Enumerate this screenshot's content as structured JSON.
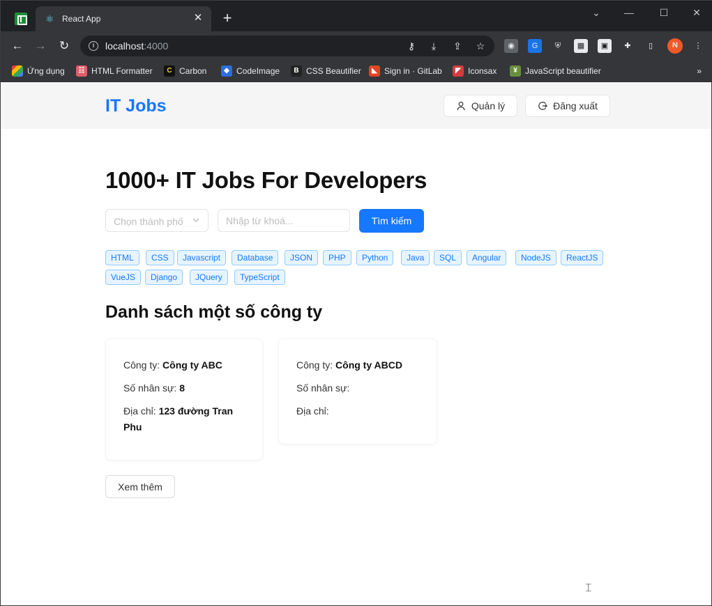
{
  "browser": {
    "tab_title": "React App",
    "url_host": "localhost",
    "url_port": ":4000",
    "bookmarks": [
      {
        "label": "Ứng dụng",
        "icon": "apps-grid-icon",
        "color": "#ea4335"
      },
      {
        "label": "HTML Formatter",
        "icon": "html-formatter-icon",
        "color": "#e25d6b"
      },
      {
        "label": "Carbon",
        "icon": "carbon-icon",
        "color": "#111111"
      },
      {
        "label": "CodeImage",
        "icon": "codeimage-icon",
        "color": "#2d6cdf"
      },
      {
        "label": "CSS Beautifier",
        "icon": "css-beautifier-icon",
        "color": "#222222"
      },
      {
        "label": "Sign in · GitLab",
        "icon": "gitlab-icon",
        "color": "#e24329"
      },
      {
        "label": "Iconsax",
        "icon": "iconsax-icon",
        "color": "#d43c3c"
      },
      {
        "label": "JavaScript beautifier",
        "icon": "js-beautifier-icon",
        "color": "#6a8f3c"
      }
    ],
    "bookmarks_more": "»",
    "profile_initial": "N"
  },
  "header": {
    "logo": "IT Jobs",
    "manage_label": "Quản lý",
    "logout_label": "Đăng xuất"
  },
  "hero": {
    "title": "1000+ IT Jobs For Developers",
    "city_placeholder": "Chọn thành phố",
    "keyword_placeholder": "Nhập từ khoá...",
    "search_label": "Tìm kiếm"
  },
  "tags": [
    "HTML",
    "CSS",
    "Javascript",
    "Database",
    "JSON",
    "PHP",
    "Python",
    "Java",
    "SQL",
    "Angular",
    "NodeJS",
    "ReactJS",
    "VueJS",
    "Django",
    "JQuery",
    "TypeScript"
  ],
  "companies_section": {
    "title": "Danh sách một số công ty",
    "company_label": "Công ty:",
    "staff_label": "Số nhân sự:",
    "address_label": "Địa chỉ:",
    "companies": [
      {
        "name": "Công ty ABC",
        "staff": "8",
        "address": "123 đường Tran Phu"
      },
      {
        "name": "Công ty ABCD",
        "staff": "",
        "address": ""
      }
    ],
    "more_label": "Xem thêm"
  },
  "colors": {
    "primary": "#1677ff",
    "tag_bg": "#e6f4ff",
    "tag_border": "#91caff",
    "header_bg": "#f5f5f5"
  }
}
